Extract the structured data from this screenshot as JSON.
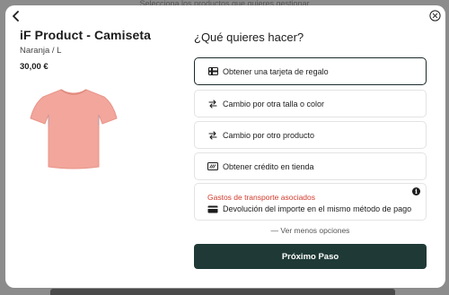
{
  "background": {
    "top_text": "Selecciona los productos que quieres gestionar"
  },
  "modal": {
    "product": {
      "title": "iF Product - Camiseta",
      "variant": "Naranja / L",
      "price": "30,00 €",
      "image_icon": "tshirt-icon",
      "shirt_color": "#f2a69c"
    },
    "question": "¿Qué quieres hacer?",
    "options": [
      {
        "label": "Obtener una tarjeta de regalo",
        "icon": "gift-card-icon",
        "selected": true
      },
      {
        "label": "Cambio por otra talla o color",
        "icon": "exchange-arrows-icon",
        "selected": false
      },
      {
        "label": "Cambio por otro producto",
        "icon": "exchange-arrows-icon",
        "selected": false
      },
      {
        "label": "Obtener crédito en tienda",
        "icon": "store-credit-icon",
        "selected": false
      }
    ],
    "refund_option": {
      "shipping_note": "Gastos de transporte asociados",
      "label": "Devolución del importe en el mismo método de pago",
      "icon": "credit-card-icon",
      "info": "i"
    },
    "less_options": "— Ver menos opciones",
    "next_button": "Próximo Paso",
    "colors": {
      "primary": "#1f3a36",
      "warning": "#d23a2c"
    }
  }
}
